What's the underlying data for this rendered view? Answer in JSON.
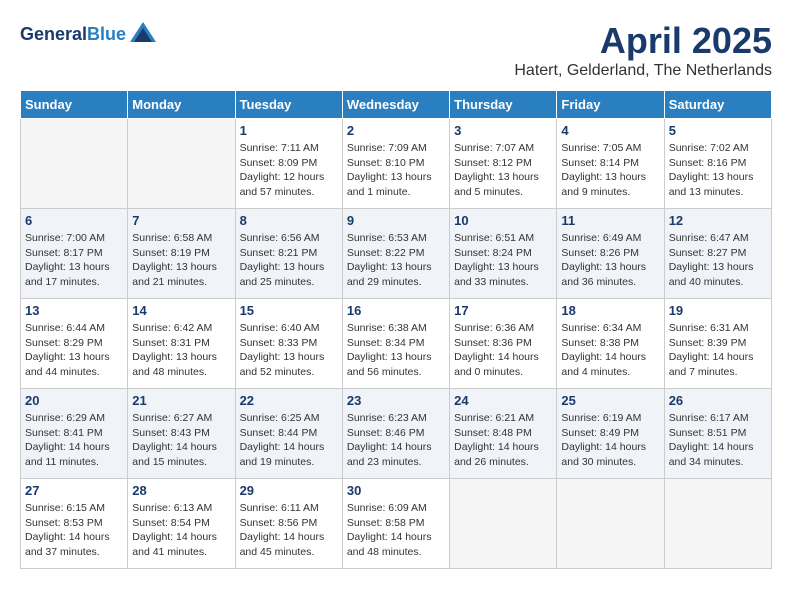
{
  "logo": {
    "line1": "General",
    "line2": "Blue"
  },
  "title": "April 2025",
  "subtitle": "Hatert, Gelderland, The Netherlands",
  "headers": [
    "Sunday",
    "Monday",
    "Tuesday",
    "Wednesday",
    "Thursday",
    "Friday",
    "Saturday"
  ],
  "weeks": [
    [
      {
        "day": "",
        "sunrise": "",
        "sunset": "",
        "daylight": ""
      },
      {
        "day": "",
        "sunrise": "",
        "sunset": "",
        "daylight": ""
      },
      {
        "day": "1",
        "sunrise": "Sunrise: 7:11 AM",
        "sunset": "Sunset: 8:09 PM",
        "daylight": "Daylight: 12 hours and 57 minutes."
      },
      {
        "day": "2",
        "sunrise": "Sunrise: 7:09 AM",
        "sunset": "Sunset: 8:10 PM",
        "daylight": "Daylight: 13 hours and 1 minute."
      },
      {
        "day": "3",
        "sunrise": "Sunrise: 7:07 AM",
        "sunset": "Sunset: 8:12 PM",
        "daylight": "Daylight: 13 hours and 5 minutes."
      },
      {
        "day": "4",
        "sunrise": "Sunrise: 7:05 AM",
        "sunset": "Sunset: 8:14 PM",
        "daylight": "Daylight: 13 hours and 9 minutes."
      },
      {
        "day": "5",
        "sunrise": "Sunrise: 7:02 AM",
        "sunset": "Sunset: 8:16 PM",
        "daylight": "Daylight: 13 hours and 13 minutes."
      }
    ],
    [
      {
        "day": "6",
        "sunrise": "Sunrise: 7:00 AM",
        "sunset": "Sunset: 8:17 PM",
        "daylight": "Daylight: 13 hours and 17 minutes."
      },
      {
        "day": "7",
        "sunrise": "Sunrise: 6:58 AM",
        "sunset": "Sunset: 8:19 PM",
        "daylight": "Daylight: 13 hours and 21 minutes."
      },
      {
        "day": "8",
        "sunrise": "Sunrise: 6:56 AM",
        "sunset": "Sunset: 8:21 PM",
        "daylight": "Daylight: 13 hours and 25 minutes."
      },
      {
        "day": "9",
        "sunrise": "Sunrise: 6:53 AM",
        "sunset": "Sunset: 8:22 PM",
        "daylight": "Daylight: 13 hours and 29 minutes."
      },
      {
        "day": "10",
        "sunrise": "Sunrise: 6:51 AM",
        "sunset": "Sunset: 8:24 PM",
        "daylight": "Daylight: 13 hours and 33 minutes."
      },
      {
        "day": "11",
        "sunrise": "Sunrise: 6:49 AM",
        "sunset": "Sunset: 8:26 PM",
        "daylight": "Daylight: 13 hours and 36 minutes."
      },
      {
        "day": "12",
        "sunrise": "Sunrise: 6:47 AM",
        "sunset": "Sunset: 8:27 PM",
        "daylight": "Daylight: 13 hours and 40 minutes."
      }
    ],
    [
      {
        "day": "13",
        "sunrise": "Sunrise: 6:44 AM",
        "sunset": "Sunset: 8:29 PM",
        "daylight": "Daylight: 13 hours and 44 minutes."
      },
      {
        "day": "14",
        "sunrise": "Sunrise: 6:42 AM",
        "sunset": "Sunset: 8:31 PM",
        "daylight": "Daylight: 13 hours and 48 minutes."
      },
      {
        "day": "15",
        "sunrise": "Sunrise: 6:40 AM",
        "sunset": "Sunset: 8:33 PM",
        "daylight": "Daylight: 13 hours and 52 minutes."
      },
      {
        "day": "16",
        "sunrise": "Sunrise: 6:38 AM",
        "sunset": "Sunset: 8:34 PM",
        "daylight": "Daylight: 13 hours and 56 minutes."
      },
      {
        "day": "17",
        "sunrise": "Sunrise: 6:36 AM",
        "sunset": "Sunset: 8:36 PM",
        "daylight": "Daylight: 14 hours and 0 minutes."
      },
      {
        "day": "18",
        "sunrise": "Sunrise: 6:34 AM",
        "sunset": "Sunset: 8:38 PM",
        "daylight": "Daylight: 14 hours and 4 minutes."
      },
      {
        "day": "19",
        "sunrise": "Sunrise: 6:31 AM",
        "sunset": "Sunset: 8:39 PM",
        "daylight": "Daylight: 14 hours and 7 minutes."
      }
    ],
    [
      {
        "day": "20",
        "sunrise": "Sunrise: 6:29 AM",
        "sunset": "Sunset: 8:41 PM",
        "daylight": "Daylight: 14 hours and 11 minutes."
      },
      {
        "day": "21",
        "sunrise": "Sunrise: 6:27 AM",
        "sunset": "Sunset: 8:43 PM",
        "daylight": "Daylight: 14 hours and 15 minutes."
      },
      {
        "day": "22",
        "sunrise": "Sunrise: 6:25 AM",
        "sunset": "Sunset: 8:44 PM",
        "daylight": "Daylight: 14 hours and 19 minutes."
      },
      {
        "day": "23",
        "sunrise": "Sunrise: 6:23 AM",
        "sunset": "Sunset: 8:46 PM",
        "daylight": "Daylight: 14 hours and 23 minutes."
      },
      {
        "day": "24",
        "sunrise": "Sunrise: 6:21 AM",
        "sunset": "Sunset: 8:48 PM",
        "daylight": "Daylight: 14 hours and 26 minutes."
      },
      {
        "day": "25",
        "sunrise": "Sunrise: 6:19 AM",
        "sunset": "Sunset: 8:49 PM",
        "daylight": "Daylight: 14 hours and 30 minutes."
      },
      {
        "day": "26",
        "sunrise": "Sunrise: 6:17 AM",
        "sunset": "Sunset: 8:51 PM",
        "daylight": "Daylight: 14 hours and 34 minutes."
      }
    ],
    [
      {
        "day": "27",
        "sunrise": "Sunrise: 6:15 AM",
        "sunset": "Sunset: 8:53 PM",
        "daylight": "Daylight: 14 hours and 37 minutes."
      },
      {
        "day": "28",
        "sunrise": "Sunrise: 6:13 AM",
        "sunset": "Sunset: 8:54 PM",
        "daylight": "Daylight: 14 hours and 41 minutes."
      },
      {
        "day": "29",
        "sunrise": "Sunrise: 6:11 AM",
        "sunset": "Sunset: 8:56 PM",
        "daylight": "Daylight: 14 hours and 45 minutes."
      },
      {
        "day": "30",
        "sunrise": "Sunrise: 6:09 AM",
        "sunset": "Sunset: 8:58 PM",
        "daylight": "Daylight: 14 hours and 48 minutes."
      },
      {
        "day": "",
        "sunrise": "",
        "sunset": "",
        "daylight": ""
      },
      {
        "day": "",
        "sunrise": "",
        "sunset": "",
        "daylight": ""
      },
      {
        "day": "",
        "sunrise": "",
        "sunset": "",
        "daylight": ""
      }
    ]
  ]
}
